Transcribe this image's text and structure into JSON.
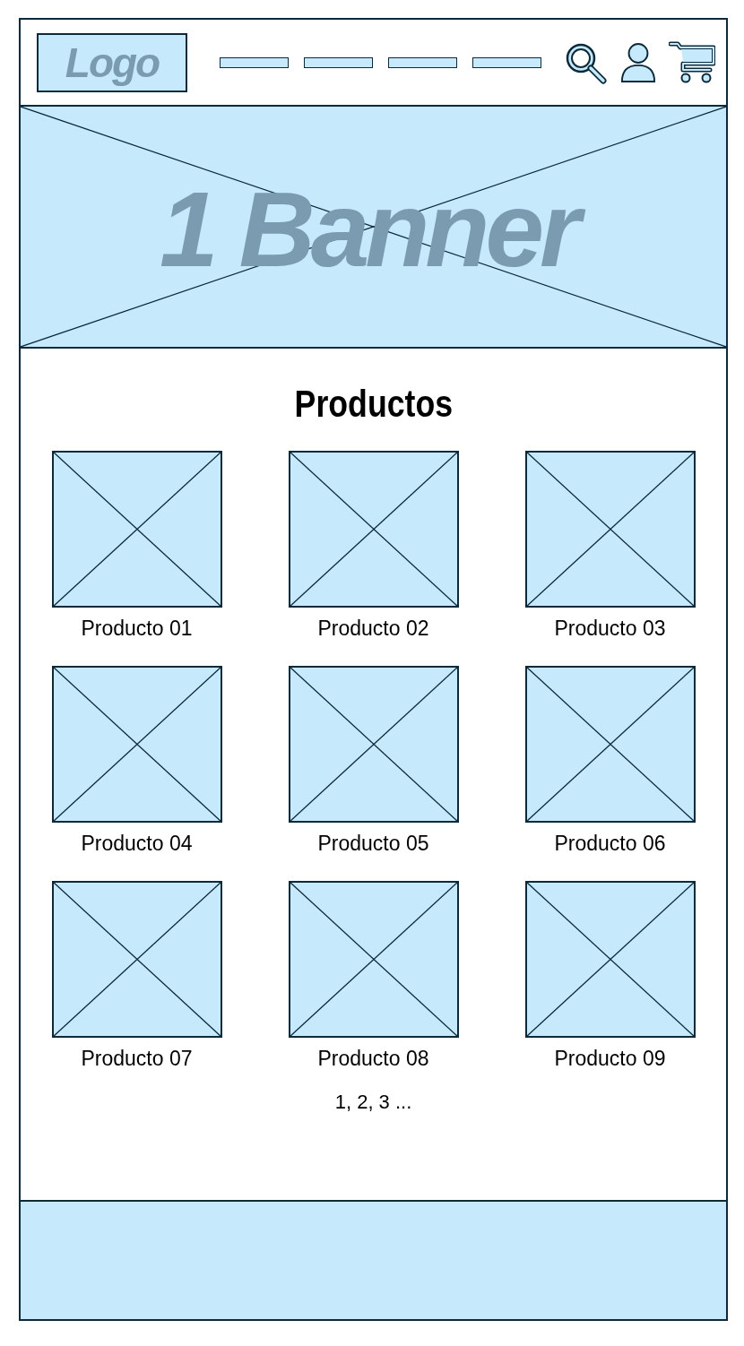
{
  "header": {
    "logo": "Logo"
  },
  "banner": {
    "text": "1 Banner"
  },
  "products": {
    "title": "Productos",
    "items": [
      {
        "name": "Producto 01"
      },
      {
        "name": "Producto 02"
      },
      {
        "name": "Producto 03"
      },
      {
        "name": "Producto 04"
      },
      {
        "name": "Producto 05"
      },
      {
        "name": "Producto 06"
      },
      {
        "name": "Producto 07"
      },
      {
        "name": "Producto 08"
      },
      {
        "name": "Producto 09"
      }
    ],
    "pagination": "1, 2, 3 ..."
  }
}
